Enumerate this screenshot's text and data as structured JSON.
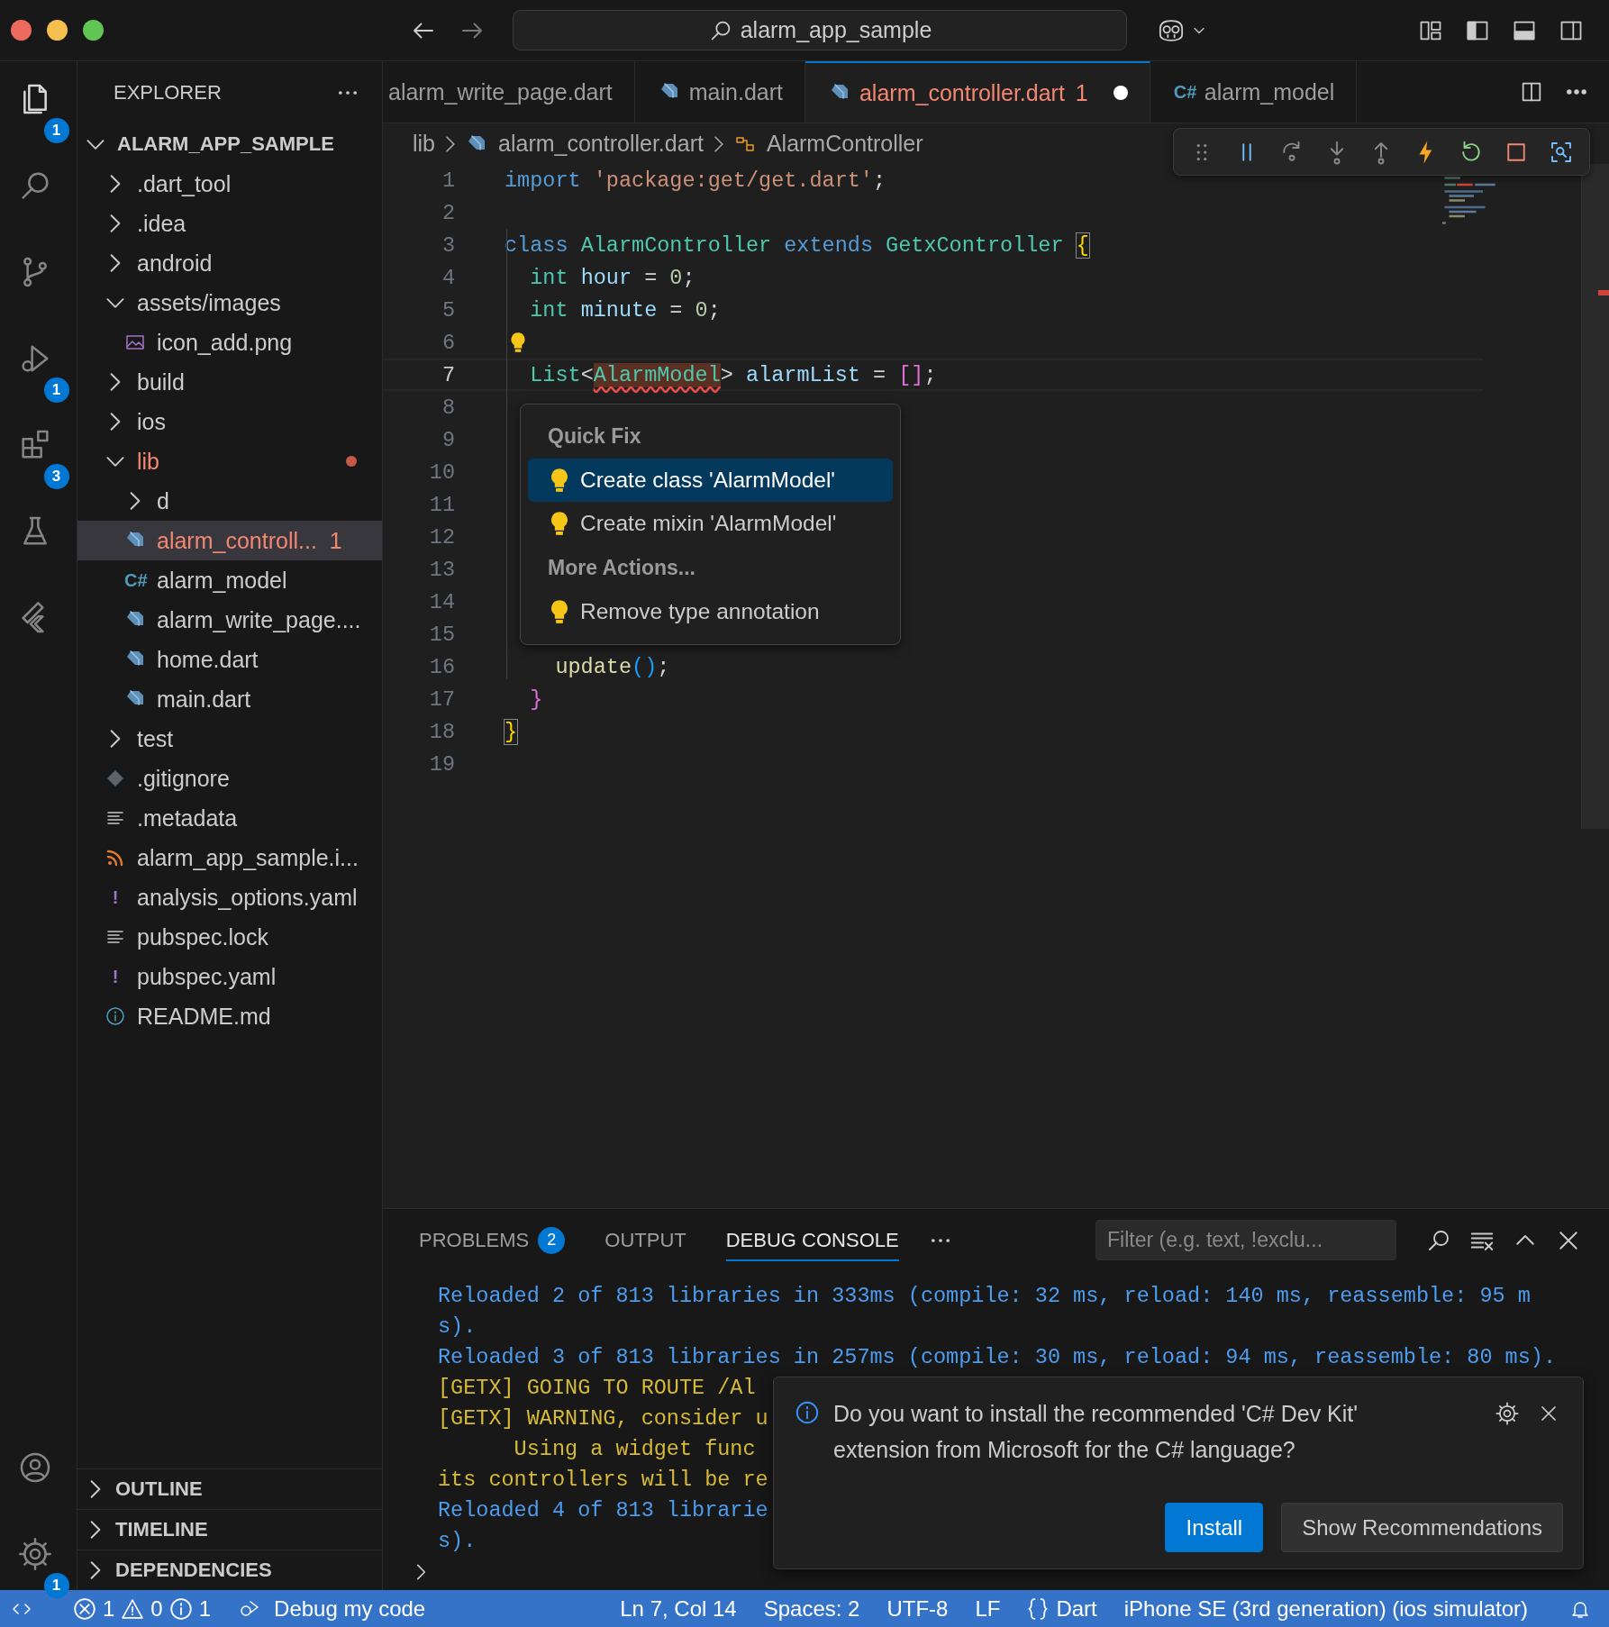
{
  "window": {
    "title": "alarm_app_sample"
  },
  "activity_bar": {
    "top": [
      {
        "kind": "files",
        "badge": "1",
        "selected": true
      },
      {
        "kind": "search",
        "selected": false
      },
      {
        "kind": "source-control",
        "selected": false
      },
      {
        "kind": "run-debug",
        "badge": "1",
        "selected": false
      },
      {
        "kind": "extensions",
        "badge": "3",
        "selected": false
      },
      {
        "kind": "testing",
        "selected": false
      },
      {
        "kind": "flutter",
        "selected": false
      }
    ],
    "bottom": [
      {
        "kind": "account"
      },
      {
        "kind": "settings",
        "badge": "1"
      }
    ]
  },
  "sidebar": {
    "title": "EXPLORER",
    "tree": {
      "label": "ALARM_APP_SAMPLE",
      "kind": "root",
      "expanded": true,
      "selected": false,
      "error": false,
      "children": [
        {
          "label": ".dart_tool",
          "kind": "folder",
          "expanded": false,
          "selected": false,
          "error": false
        },
        {
          "label": ".idea",
          "kind": "folder",
          "expanded": false,
          "selected": false,
          "error": false
        },
        {
          "label": "android",
          "kind": "folder",
          "expanded": false,
          "selected": false,
          "error": false
        },
        {
          "label": "assets/images",
          "kind": "folder",
          "expanded": true,
          "selected": false,
          "error": false,
          "children": [
            {
              "label": "icon_add.png",
              "kind": "image",
              "selected": false,
              "error": false
            }
          ]
        },
        {
          "label": "build",
          "kind": "folder",
          "expanded": false,
          "selected": false,
          "error": false
        },
        {
          "label": "ios",
          "kind": "folder",
          "expanded": false,
          "selected": false,
          "error": false
        },
        {
          "label": "lib",
          "kind": "folder",
          "expanded": true,
          "selected": false,
          "error": true,
          "modified": true,
          "children": [
            {
              "label": "d",
              "kind": "folder",
              "expanded": false,
              "selected": false,
              "error": false
            },
            {
              "label": "alarm_controll...",
              "kind": "dart",
              "selected": true,
              "error": true,
              "badge": "1"
            },
            {
              "label": "alarm_model",
              "kind": "csharp",
              "icon_text": "C#",
              "selected": false,
              "error": false
            },
            {
              "label": "alarm_write_page....",
              "kind": "dart",
              "selected": false,
              "error": false
            },
            {
              "label": "home.dart",
              "kind": "dart",
              "selected": false,
              "error": false
            },
            {
              "label": "main.dart",
              "kind": "dart",
              "selected": false,
              "error": false
            }
          ]
        },
        {
          "label": "test",
          "kind": "folder",
          "expanded": false,
          "selected": false,
          "error": false
        },
        {
          "label": ".gitignore",
          "kind": "git",
          "selected": false,
          "error": false
        },
        {
          "label": ".metadata",
          "kind": "lines",
          "selected": false,
          "error": false
        },
        {
          "label": "alarm_app_sample.i...",
          "kind": "rss",
          "selected": false,
          "error": false
        },
        {
          "label": "analysis_options.yaml",
          "kind": "yaml",
          "icon_text": "!",
          "selected": false,
          "error": false
        },
        {
          "label": "pubspec.lock",
          "kind": "lines",
          "selected": false,
          "error": false
        },
        {
          "label": "pubspec.yaml",
          "kind": "yaml",
          "icon_text": "!",
          "selected": false,
          "error": false
        },
        {
          "label": "README.md",
          "kind": "info",
          "selected": false,
          "error": false
        }
      ]
    },
    "sections": [
      {
        "label": "OUTLINE",
        "expanded": false
      },
      {
        "label": "TIMELINE",
        "expanded": false
      },
      {
        "label": "DEPENDENCIES",
        "expanded": false
      }
    ]
  },
  "tabs": [
    {
      "label": "alarm_write_page.dart",
      "kind": "plain",
      "selected": false,
      "error": false,
      "dirty": false
    },
    {
      "label": "main.dart",
      "kind": "dart",
      "selected": false,
      "error": false,
      "dirty": false
    },
    {
      "label": "alarm_controller.dart",
      "kind": "dart",
      "selected": true,
      "error": true,
      "badge": "1",
      "dirty": true
    },
    {
      "label": "alarm_model",
      "kind": "csharp",
      "icon_text": "C#",
      "selected": false,
      "error": false,
      "dirty": false
    }
  ],
  "breadcrumb": [
    {
      "label": "lib",
      "kind": "folder"
    },
    {
      "label": "alarm_controller.dart",
      "kind": "dart"
    },
    {
      "label": "AlarmController",
      "kind": "class"
    }
  ],
  "debug_toolbar": [
    {
      "kind": "grip"
    },
    {
      "kind": "pause"
    },
    {
      "kind": "step-over"
    },
    {
      "kind": "step-into"
    },
    {
      "kind": "step-out"
    },
    {
      "kind": "hot-reload"
    },
    {
      "kind": "restart"
    },
    {
      "kind": "stop"
    },
    {
      "kind": "inspect"
    }
  ],
  "editor": {
    "lines": [
      {
        "number": "1",
        "current": false,
        "lightbulb": false,
        "tokens": [
          {
            "text": "import ",
            "kind": "kw"
          },
          {
            "text": "'package:get/get.dart'",
            "kind": "str"
          },
          {
            "text": ";",
            "kind": "plain"
          }
        ]
      },
      {
        "number": "2",
        "current": false,
        "lightbulb": false
      },
      {
        "number": "3",
        "current": false,
        "lightbulb": false,
        "tokens": [
          {
            "text": "class ",
            "kind": "kw"
          },
          {
            "text": "AlarmController ",
            "kind": "type"
          },
          {
            "text": "extends ",
            "kind": "kw"
          },
          {
            "text": "GetxController ",
            "kind": "type"
          },
          {
            "text": "{",
            "kind": "bracket-match"
          }
        ]
      },
      {
        "number": "4",
        "current": false,
        "lightbulb": false,
        "tokens": [
          {
            "text": "  int ",
            "kind": "type"
          },
          {
            "text": "hour",
            "kind": "var"
          },
          {
            "text": " = ",
            "kind": "plain"
          },
          {
            "text": "0",
            "kind": "num"
          },
          {
            "text": ";",
            "kind": "plain"
          }
        ]
      },
      {
        "number": "5",
        "current": false,
        "lightbulb": false,
        "tokens": [
          {
            "text": "  int ",
            "kind": "type"
          },
          {
            "text": "minute",
            "kind": "var"
          },
          {
            "text": " = ",
            "kind": "plain"
          },
          {
            "text": "0",
            "kind": "num"
          },
          {
            "text": ";",
            "kind": "plain"
          }
        ]
      },
      {
        "number": "6",
        "current": false,
        "lightbulb": true
      },
      {
        "number": "7",
        "current": true,
        "lightbulb": false,
        "tokens": [
          {
            "text": "  List",
            "kind": "type"
          },
          {
            "text": "<",
            "kind": "plain"
          },
          {
            "text": "AlarmModel",
            "kind": "error"
          },
          {
            "text": "> ",
            "kind": "plain"
          },
          {
            "text": "alarmList",
            "kind": "var"
          },
          {
            "text": " = ",
            "kind": "plain"
          },
          {
            "text": "[]",
            "kind": "bracket2"
          },
          {
            "text": ";",
            "kind": "plain"
          }
        ]
      },
      {
        "number": "8",
        "current": false,
        "lightbulb": false
      },
      {
        "number": "9",
        "current": false,
        "lightbulb": false
      },
      {
        "number": "10",
        "current": false,
        "lightbulb": false
      },
      {
        "number": "11",
        "current": false,
        "lightbulb": false
      },
      {
        "number": "12",
        "current": false,
        "lightbulb": false
      },
      {
        "number": "13",
        "current": false,
        "lightbulb": false
      },
      {
        "number": "14",
        "current": false,
        "lightbulb": false
      },
      {
        "number": "15",
        "current": false,
        "lightbulb": false
      },
      {
        "number": "16",
        "current": false,
        "lightbulb": false,
        "tokens": [
          {
            "text": "    update",
            "kind": "fn"
          },
          {
            "text": "()",
            "kind": "bracket3"
          },
          {
            "text": ";",
            "kind": "plain"
          }
        ]
      },
      {
        "number": "17",
        "current": false,
        "lightbulb": false,
        "tokens": [
          {
            "text": "  }",
            "kind": "bracket2"
          }
        ]
      },
      {
        "number": "18",
        "current": false,
        "lightbulb": false,
        "tokens": [
          {
            "text": "}",
            "kind": "bracket-match"
          }
        ]
      },
      {
        "number": "19",
        "current": false,
        "lightbulb": false
      }
    ]
  },
  "quick_fix": {
    "items": [
      {
        "label": "Quick Fix",
        "kind": "header"
      },
      {
        "label": "Create class 'AlarmModel'",
        "kind": "action",
        "selected": true
      },
      {
        "label": "Create mixin 'AlarmModel'",
        "kind": "action",
        "selected": false
      },
      {
        "label": "More Actions...",
        "kind": "header"
      },
      {
        "label": "Remove type annotation",
        "kind": "action",
        "selected": false
      }
    ]
  },
  "panel": {
    "tabs": [
      {
        "label": "PROBLEMS",
        "badge": "2",
        "selected": false
      },
      {
        "label": "OUTPUT",
        "selected": false
      },
      {
        "label": "DEBUG CONSOLE",
        "selected": true
      }
    ],
    "filter": {
      "placeholder": "Filter (e.g. text, !exclu..."
    },
    "console": [
      {
        "text": "Reloaded 2 of 813 libraries in 333ms (compile: 32 ms, reload: 140 ms, reassemble: 95 m",
        "kind": "info"
      },
      {
        "text": "s).",
        "kind": "info"
      },
      {
        "text": "Reloaded 3 of 813 libraries in 257ms (compile: 30 ms, reload: 94 ms, reassemble: 80 ms).",
        "kind": "info"
      },
      {
        "text": "[GETX] GOING TO ROUTE /Al",
        "kind": "warn"
      },
      {
        "text": "[GETX] WARNING, consider u",
        "kind": "warn"
      },
      {
        "text": "      Using a widget func",
        "kind": "warn"
      },
      {
        "text": "its controllers will be re",
        "kind": "warn"
      },
      {
        "text": "Reloaded 4 of 813 librarie",
        "kind": "info"
      },
      {
        "text": "s).",
        "kind": "info"
      }
    ]
  },
  "notification": {
    "message": "Do you want to install the recommended 'C# Dev Kit' extension from Microsoft for the C# language?",
    "buttons": [
      {
        "label": "Install",
        "kind": "primary"
      },
      {
        "label": "Show Recommendations",
        "kind": "secondary"
      }
    ]
  },
  "status_bar": {
    "errors": "1",
    "warnings": "0",
    "infos": "1",
    "debug_label": "Debug my code",
    "items": [
      {
        "label": "Ln 7, Col 14",
        "kind": "text"
      },
      {
        "label": "Spaces: 2",
        "kind": "text"
      },
      {
        "label": "UTF-8",
        "kind": "text"
      },
      {
        "label": "LF",
        "kind": "text"
      },
      {
        "label": "Dart",
        "kind": "language"
      },
      {
        "label": "iPhone SE (3rd generation) (ios simulator)",
        "kind": "text"
      }
    ]
  }
}
